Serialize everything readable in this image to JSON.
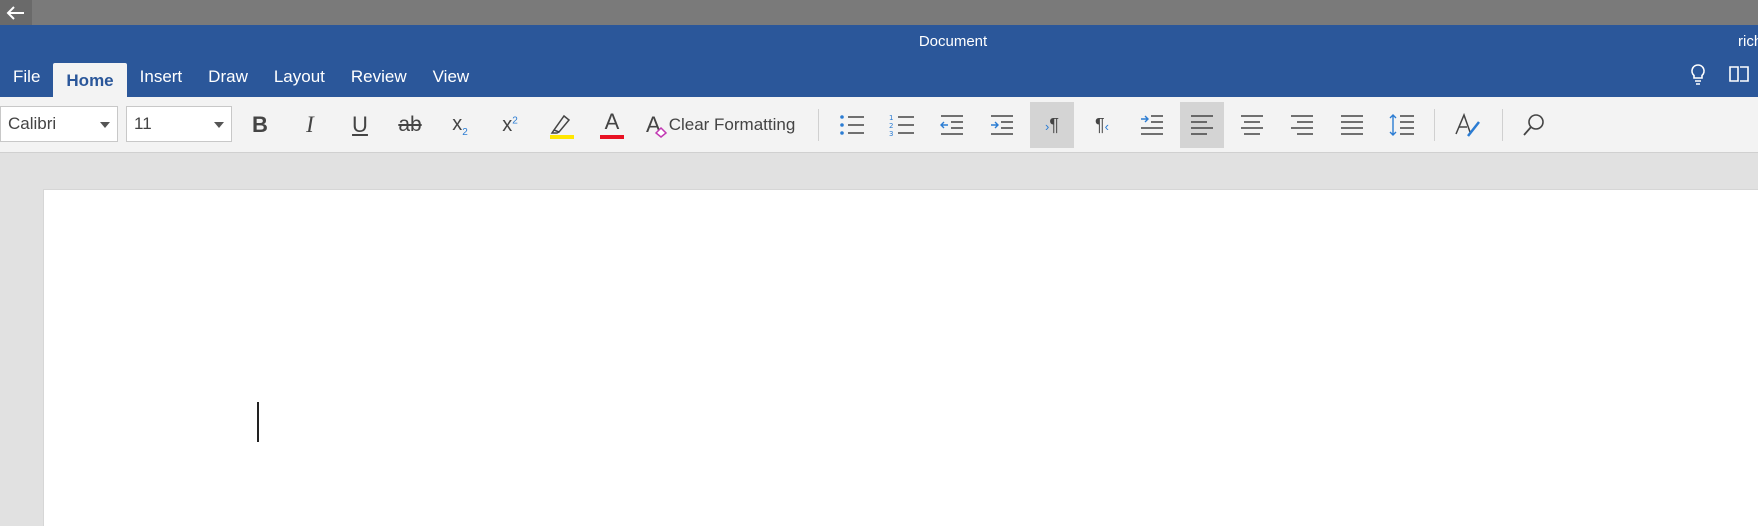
{
  "window": {
    "title": "Document",
    "user": "rich"
  },
  "tabs": [
    {
      "label": "File",
      "active": false
    },
    {
      "label": "Home",
      "active": true
    },
    {
      "label": "Insert",
      "active": false
    },
    {
      "label": "Draw",
      "active": false
    },
    {
      "label": "Layout",
      "active": false
    },
    {
      "label": "Review",
      "active": false
    },
    {
      "label": "View",
      "active": false
    }
  ],
  "ribbon": {
    "font_name": "Calibri",
    "font_size": "11",
    "clear_formatting_label": "Clear Formatting",
    "bold_glyph": "B",
    "italic_glyph": "I",
    "underline_glyph": "U",
    "strike_glyph": "ab",
    "subscript_glyph": "x",
    "subscript_mark": "2",
    "superscript_glyph": "x",
    "superscript_mark": "2",
    "font_color_glyph": "A",
    "clear_glyph": "A",
    "ltr_glyph": "¶",
    "rtl_glyph": "¶"
  },
  "colors": {
    "brand": "#2b579a",
    "highlight": "#ffe600",
    "font_color": "#e81123",
    "accent_blue": "#2b7cd3"
  }
}
